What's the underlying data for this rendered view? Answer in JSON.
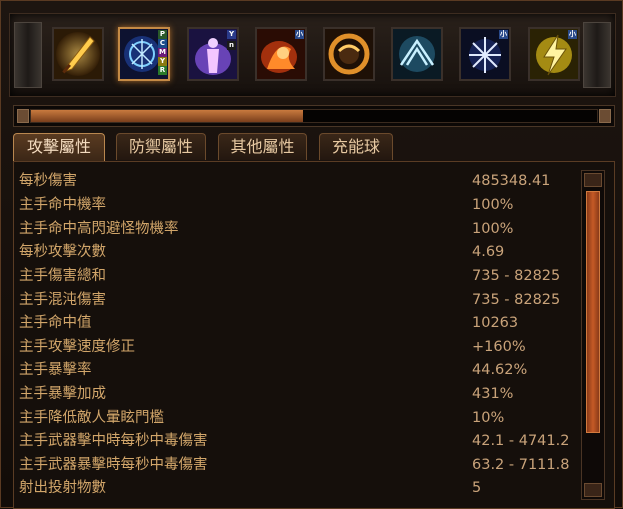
{
  "skills": [
    {
      "name": "sword-skill-icon",
      "selected": false
    },
    {
      "name": "runes-skill-icon",
      "selected": true,
      "badges": [
        "P",
        "C",
        "M",
        "Y",
        "R"
      ]
    },
    {
      "name": "aura-skill-icon",
      "selected": false,
      "badges": [
        "Y",
        "n"
      ]
    },
    {
      "name": "fire-skill-icon",
      "selected": false,
      "badges": [
        "小"
      ]
    },
    {
      "name": "ring-skill-icon",
      "selected": false
    },
    {
      "name": "wings-skill-icon",
      "selected": false
    },
    {
      "name": "snowflake-skill-icon",
      "selected": false,
      "badges": [
        "小"
      ]
    },
    {
      "name": "lightning-skill-icon",
      "selected": false,
      "badges": [
        "小"
      ]
    }
  ],
  "progress": {
    "fraction": 0.48
  },
  "tabs": [
    {
      "label": "攻擊屬性",
      "active": true
    },
    {
      "label": "防禦屬性",
      "active": false
    },
    {
      "label": "其他屬性",
      "active": false
    },
    {
      "label": "充能球",
      "active": false
    }
  ],
  "stats": [
    {
      "label": "每秒傷害",
      "value": "485348.41"
    },
    {
      "label": "主手命中機率",
      "value": "100%"
    },
    {
      "label": "主手命中高閃避怪物機率",
      "value": "100%"
    },
    {
      "label": "每秒攻擊次數",
      "value": "4.69"
    },
    {
      "label": "主手傷害總和",
      "value": "735 - 82825"
    },
    {
      "label": "主手混沌傷害",
      "value": "735 - 82825"
    },
    {
      "label": "主手命中值",
      "value": "10263"
    },
    {
      "label": "主手攻擊速度修正",
      "value": "+160%"
    },
    {
      "label": "主手暴擊率",
      "value": "44.62%"
    },
    {
      "label": "主手暴擊加成",
      "value": "431%"
    },
    {
      "label": "主手降低敵人暈眩門檻",
      "value": "10%"
    },
    {
      "label": "主手武器擊中時每秒中毒傷害",
      "value": "42.1 - 4741.2"
    },
    {
      "label": "主手武器暴擊時每秒中毒傷害",
      "value": "63.2 - 7111.8"
    },
    {
      "label": "射出投射物數",
      "value": "5"
    }
  ],
  "colors": {
    "accent": "#c48a45",
    "label": "#d2a66a",
    "value": "#c9a37a",
    "scroll": "#c55a26"
  }
}
